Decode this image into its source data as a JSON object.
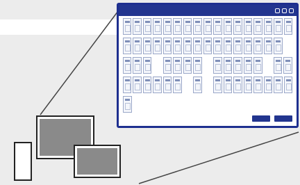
{
  "app": {
    "header_text": "",
    "title": "",
    "buttons": [
      {
        "label": ""
      },
      {
        "label": ""
      }
    ]
  },
  "tiles": {
    "rows": [
      [
        1,
        1,
        1,
        1,
        1,
        1,
        1,
        1,
        1,
        1,
        1,
        1,
        1,
        1,
        1,
        1,
        1
      ],
      [
        1,
        1,
        1,
        1,
        1,
        1,
        1,
        1,
        1,
        1,
        1,
        1,
        1,
        1,
        1,
        1,
        0
      ],
      [
        1,
        1,
        1,
        0,
        1,
        1,
        1,
        1,
        0,
        1,
        1,
        1,
        1,
        1,
        0,
        1,
        1
      ],
      [
        1,
        1,
        1,
        1,
        1,
        1,
        0,
        1,
        0,
        1,
        1,
        1,
        1,
        1,
        1,
        1,
        1
      ],
      [
        1,
        0,
        0,
        0,
        0,
        0,
        0,
        0,
        0,
        0,
        0,
        0,
        0,
        0,
        0,
        0,
        0
      ]
    ]
  },
  "icons": [
    "pencil-icon",
    "tool-icon",
    "monitor-icon"
  ],
  "colors": {
    "accent": "#22358f",
    "tile_border": "#9aa7c8",
    "background": "#ececec"
  }
}
